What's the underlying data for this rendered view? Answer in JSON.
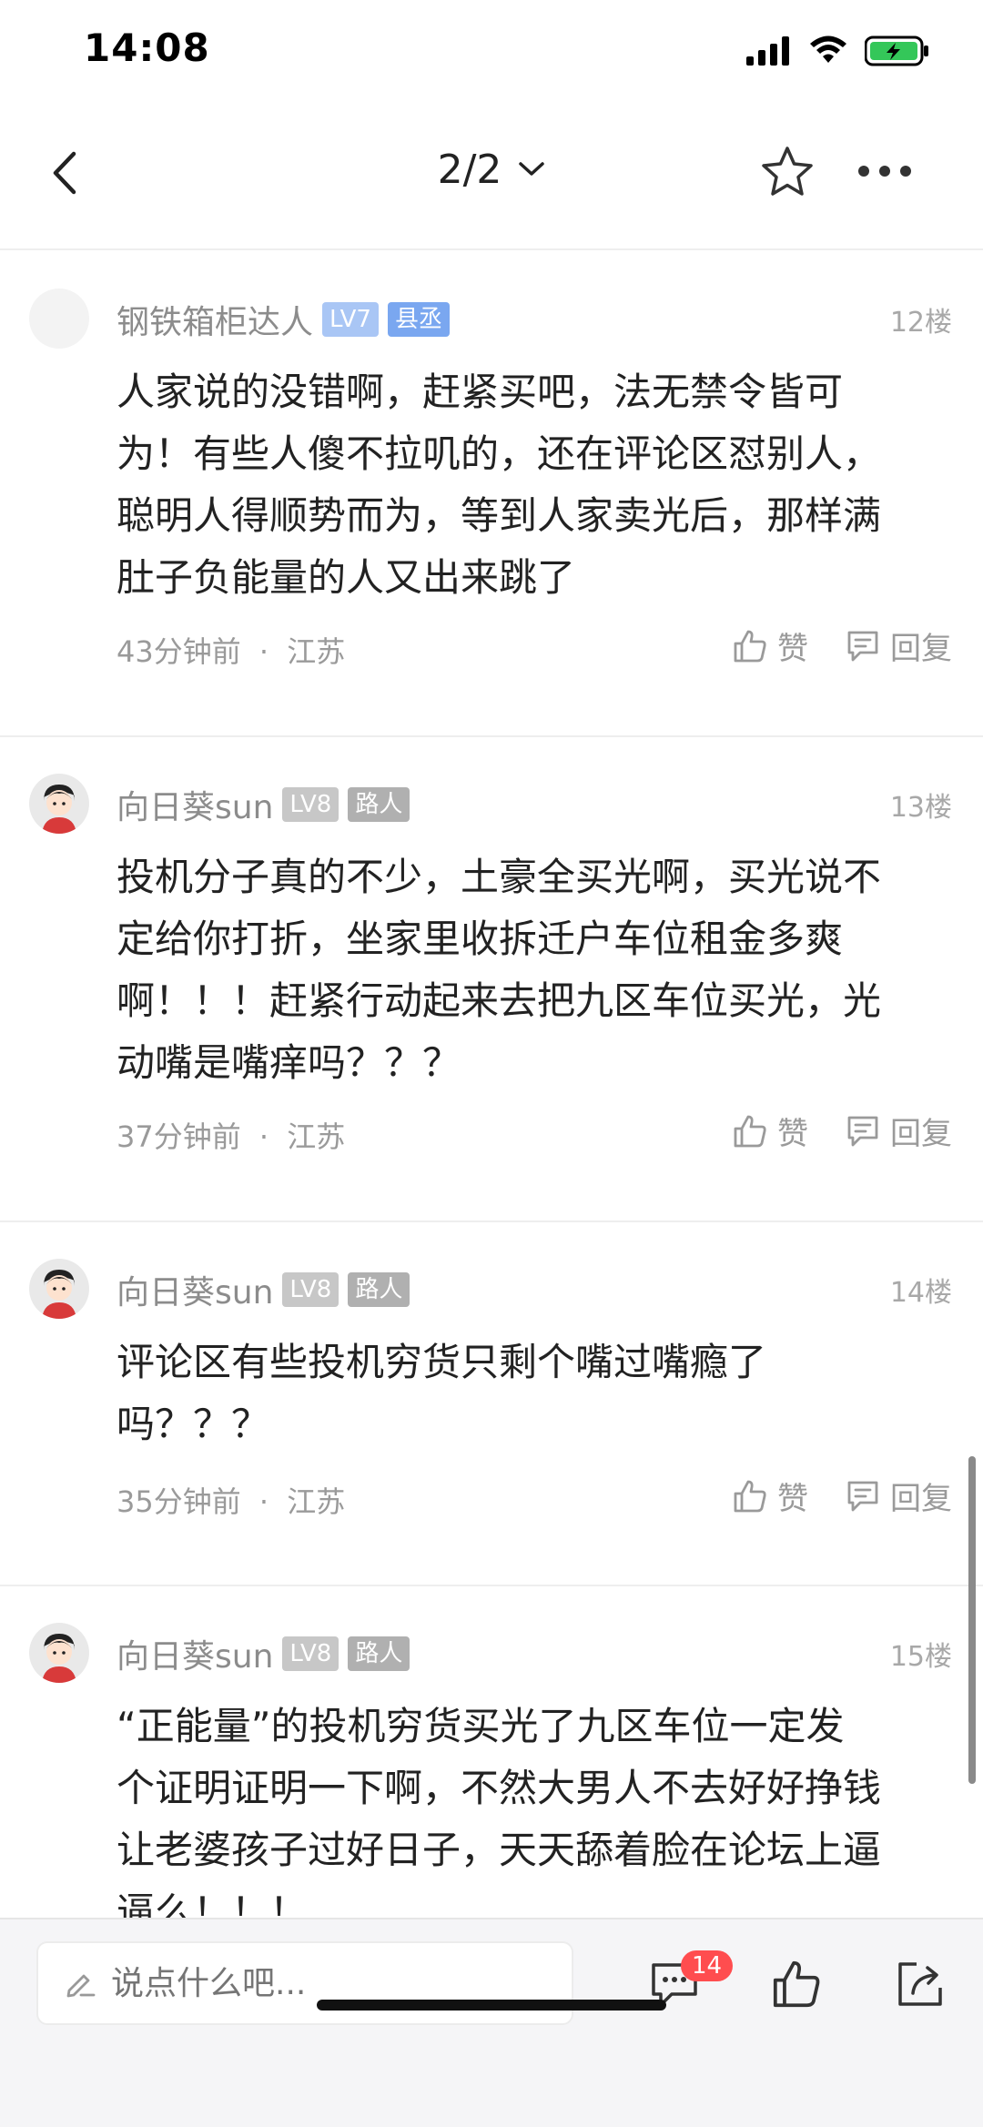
{
  "status_bar": {
    "time": "14:08"
  },
  "nav": {
    "page_indicator": "2/2"
  },
  "comments": [
    {
      "name": "钢铁箱柜达人",
      "level": "LV7",
      "title": "县丞",
      "floor": "12楼",
      "text_lines": [
        "人家说的没错啊，赶紧买吧，法无禁令皆可",
        "为！有些人傻不拉叽的，还在评论区怼别人，",
        "聪明人得顺势而为，等到人家卖光后，那样满",
        "肚子负能量的人又出来跳了"
      ],
      "time": "43分钟前",
      "location": "江苏",
      "like_label": "赞",
      "reply_label": "回复"
    },
    {
      "name": "向日葵sun",
      "level": "LV8",
      "title": "路人",
      "floor": "13楼",
      "text_lines": [
        "投机分子真的不少，土豪全买光啊，买光说不",
        "定给你打折，坐家里收拆迁户车位租金多爽",
        "啊！！！赶紧行动起来去把九区车位买光，光",
        "动嘴是嘴痒吗？？？"
      ],
      "time": "37分钟前",
      "location": "江苏",
      "like_label": "赞",
      "reply_label": "回复"
    },
    {
      "name": "向日葵sun",
      "level": "LV8",
      "title": "路人",
      "floor": "14楼",
      "text_lines": [
        "评论区有些投机穷货只剩个嘴过嘴瘾了",
        "吗？？？"
      ],
      "time": "35分钟前",
      "location": "江苏",
      "like_label": "赞",
      "reply_label": "回复"
    },
    {
      "name": "向日葵sun",
      "level": "LV8",
      "title": "路人",
      "floor": "15楼",
      "text_lines": [
        "“正能量”的投机穷货买光了九区车位一定发",
        "个证明证明一下啊，不然大男人不去好好挣钱",
        "让老婆孩子过好日子，天天舔着脸在论坛上逼",
        "逼么！！！"
      ],
      "time": "",
      "location": "",
      "like_label": "",
      "reply_label": ""
    }
  ],
  "meta_separator": "·",
  "bottom_bar": {
    "input_placeholder": "说点什么吧...",
    "comment_count": "14"
  },
  "colors": {
    "lv7_badge": "#a9c6f5",
    "title_blue": "#7aa7f0",
    "lv8_badge": "#c7c7c7",
    "title_gray": "#b0b0b0",
    "count_badge": "#ff4d4f"
  }
}
